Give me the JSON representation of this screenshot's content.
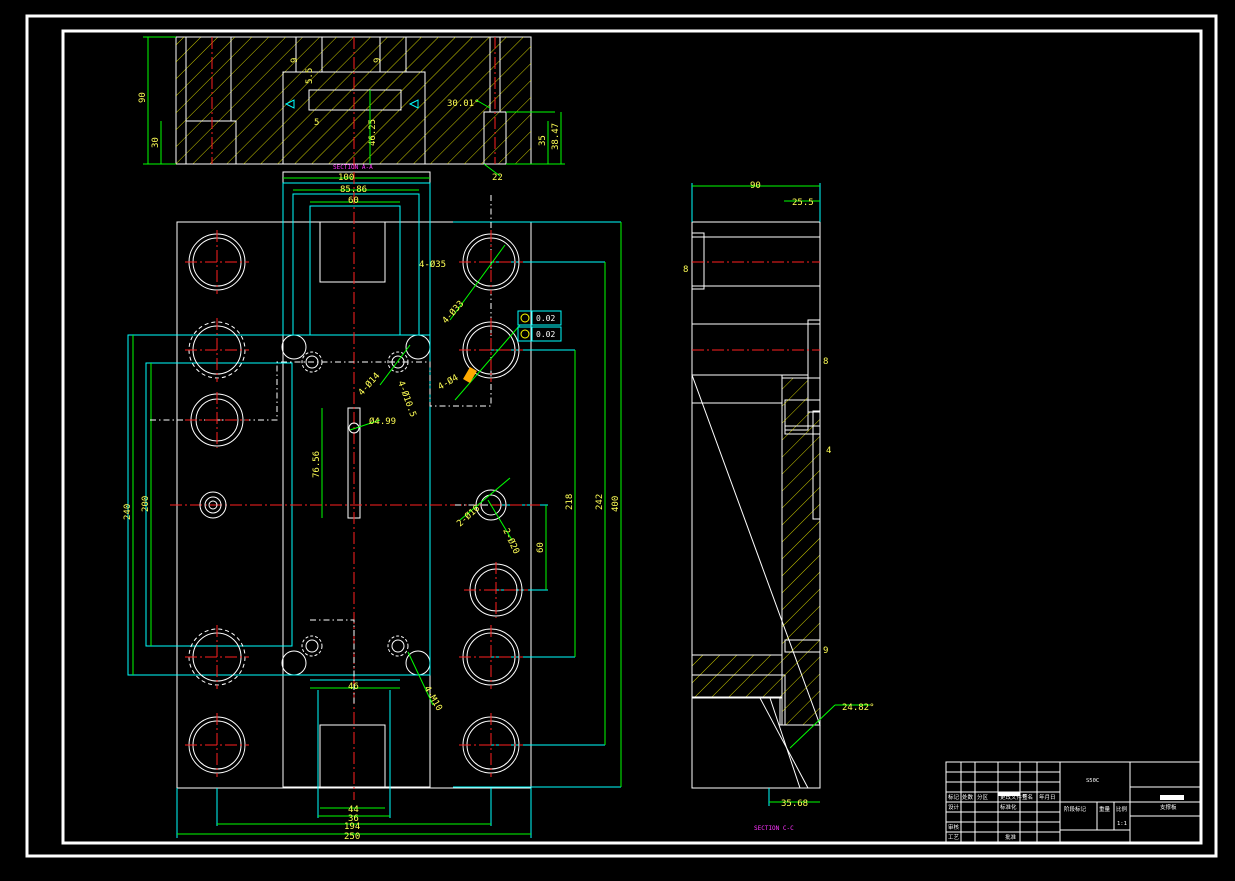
{
  "sections": {
    "top_label": "SECTION A-A",
    "right_label": "SECTION C-C"
  },
  "dims_top": {
    "h90": "90",
    "h30": "30",
    "d9a": "9",
    "d9b": "9",
    "d55": "5.5",
    "d5": "5",
    "d4625": "46.25",
    "ang": "30.01°",
    "d35": "35",
    "d3847": "38.47",
    "d22": "22"
  },
  "dims_main": {
    "w100": "100",
    "w8586": "85.86",
    "w60": "60",
    "h240": "240",
    "h200": "200",
    "h218": "218",
    "h242": "242",
    "h400": "400",
    "h7656": "76.56",
    "h60": "60",
    "w46": "46",
    "w44": "44",
    "w36": "36",
    "w194": "194",
    "w250": "250",
    "hole35": "4-Ø35",
    "hole33": "4-Ø33",
    "hole14": "4-Ø14",
    "hole105": "4-Ø10.5",
    "hole499": "Ø4.99",
    "hole16": "2-Ø16",
    "hole20": "2-Ø20",
    "hole10": "4-M10",
    "holeb": "4-Ø4",
    "tol1": "0.02",
    "tol2": "0.02"
  },
  "dims_right": {
    "w90": "90",
    "w255": "25.5",
    "d8a": "8",
    "d8b": "8",
    "d4": "4",
    "d9": "9",
    "ang": "24.82°",
    "w3568": "35.68"
  },
  "title_block": {
    "material": "S50C",
    "part": "支撑板",
    "row1": [
      "标记",
      "处数",
      "分区",
      "更改文件号",
      "签名",
      "年月日"
    ],
    "row2": [
      "设计",
      "",
      "",
      "标准化",
      "",
      ""
    ],
    "stage": [
      "阶段标记",
      "重量",
      "比例"
    ],
    "scale": "1:1",
    "check": "审核",
    "craft": "工艺",
    "approve": "批准"
  }
}
